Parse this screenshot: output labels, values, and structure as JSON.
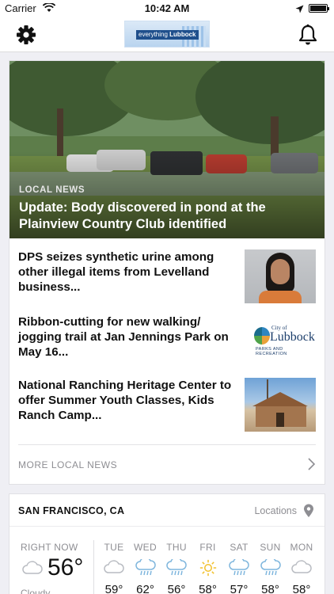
{
  "status_bar": {
    "carrier": "Carrier",
    "time": "10:42 AM"
  },
  "header": {
    "logo_text_a": "everything",
    "logo_text_b": "Lubbock",
    "settings_icon": "gear-icon",
    "notifications_icon": "bell-icon"
  },
  "featured": {
    "kicker": "LOCAL NEWS",
    "headline": "Update: Body discovered in pond at the Plainview Country Club identified"
  },
  "stories": [
    {
      "title": "DPS seizes synthetic urine among other illegal items from Levelland business..."
    },
    {
      "title": "Ribbon-cutting for new walking/ jogging trail at Jan Jennings Park on May 16..."
    },
    {
      "title": "National Ranching Heritage Center to offer Summer Youth Classes, Kids Ranch Camp..."
    }
  ],
  "parks_logo": {
    "city": "City of",
    "name": "Lubbock",
    "sub": "PARKS AND RECREATION"
  },
  "more_link": "MORE LOCAL NEWS",
  "weather": {
    "location": "SAN FRANCISCO, CA",
    "locations_label": "Locations",
    "now_label": "RIGHT NOW",
    "now_temp": "56°",
    "now_condition": "Cloudy",
    "days": [
      {
        "name": "TUE",
        "temp": "59°",
        "icon": "cloud-icon"
      },
      {
        "name": "WED",
        "temp": "62°",
        "icon": "rain-icon"
      },
      {
        "name": "THU",
        "temp": "56°",
        "icon": "rain-icon"
      },
      {
        "name": "FRI",
        "temp": "58°",
        "icon": "sun-icon"
      },
      {
        "name": "SAT",
        "temp": "57°",
        "icon": "rain-icon"
      },
      {
        "name": "SUN",
        "temp": "58°",
        "icon": "rain-icon"
      },
      {
        "name": "MON",
        "temp": "58°",
        "icon": "cloud-icon"
      }
    ]
  },
  "colors": {
    "accent_sun": "#f2c12e",
    "icon_blue": "#7fb6dd",
    "muted": "#8e8e93"
  }
}
